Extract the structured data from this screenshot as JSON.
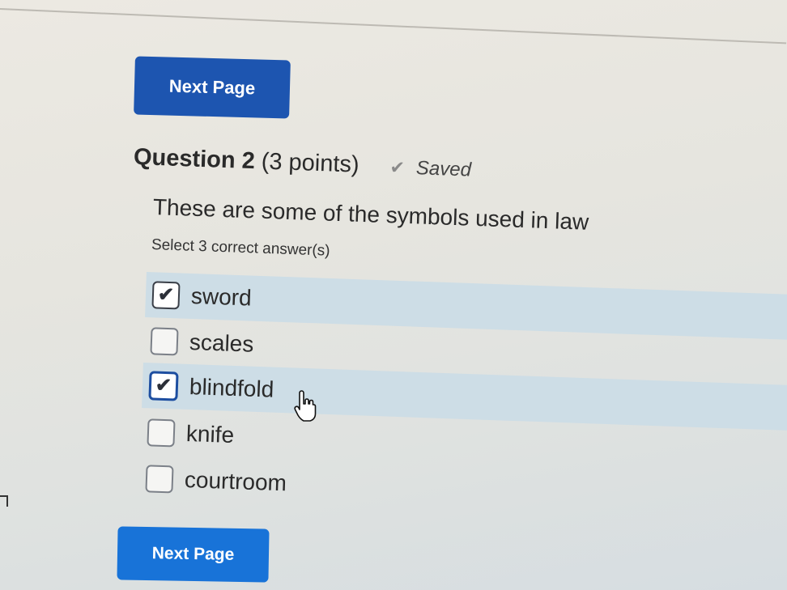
{
  "nav": {
    "next_page_label": "Next Page"
  },
  "question": {
    "title": "Question 2",
    "points": "(3 points)",
    "status_icon": "check-icon",
    "status": "Saved",
    "prompt": "These are some of the symbols used in law",
    "instruction": "Select 3 correct answer(s)",
    "options": [
      {
        "label": "sword",
        "checked": true
      },
      {
        "label": "scales",
        "checked": false
      },
      {
        "label": "blindfold",
        "checked": true
      },
      {
        "label": "knife",
        "checked": false
      },
      {
        "label": "courtroom",
        "checked": false
      }
    ]
  },
  "colors": {
    "primary_button": "#1d55b0",
    "secondary_button": "#1873d8",
    "selected_row": "#cddde6"
  }
}
